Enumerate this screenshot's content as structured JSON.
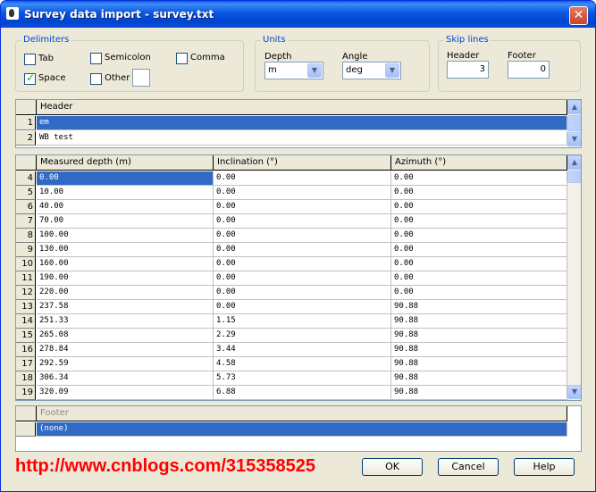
{
  "window": {
    "title": "Survey data import - survey.txt",
    "close": "✕"
  },
  "delimiters": {
    "title": "Delimiters",
    "tab": "Tab",
    "semicolon": "Semicolon",
    "comma": "Comma",
    "space": "Space",
    "other": "Other"
  },
  "units": {
    "title": "Units",
    "depth_label": "Depth",
    "depth_value": "m",
    "angle_label": "Angle",
    "angle_value": "deg"
  },
  "skip": {
    "title": "Skip lines",
    "header_label": "Header",
    "header_value": "3",
    "footer_label": "Footer",
    "footer_value": "0"
  },
  "header_grid": {
    "column": "Header",
    "rows": [
      {
        "n": "1",
        "text": "em"
      },
      {
        "n": "2",
        "text": "WB test"
      }
    ]
  },
  "data_grid": {
    "columns": [
      "Measured depth (m)",
      "Inclination (°)",
      "Azimuth (°)"
    ],
    "rows": [
      [
        "4",
        "0.00",
        "0.00",
        "0.00"
      ],
      [
        "5",
        "10.00",
        "0.00",
        "0.00"
      ],
      [
        "6",
        "40.00",
        "0.00",
        "0.00"
      ],
      [
        "7",
        "70.00",
        "0.00",
        "0.00"
      ],
      [
        "8",
        "100.00",
        "0.00",
        "0.00"
      ],
      [
        "9",
        "130.00",
        "0.00",
        "0.00"
      ],
      [
        "10",
        "160.00",
        "0.00",
        "0.00"
      ],
      [
        "11",
        "190.00",
        "0.00",
        "0.00"
      ],
      [
        "12",
        "220.00",
        "0.00",
        "0.00"
      ],
      [
        "13",
        "237.58",
        "0.00",
        "90.88"
      ],
      [
        "14",
        "251.33",
        "1.15",
        "90.88"
      ],
      [
        "15",
        "265.08",
        "2.29",
        "90.88"
      ],
      [
        "16",
        "278.84",
        "3.44",
        "90.88"
      ],
      [
        "17",
        "292.59",
        "4.58",
        "90.88"
      ],
      [
        "18",
        "306.34",
        "5.73",
        "90.88"
      ],
      [
        "19",
        "320.09",
        "6.88",
        "90.88"
      ]
    ]
  },
  "footer_grid": {
    "column": "Footer",
    "row": "(none)"
  },
  "buttons": {
    "ok": "OK",
    "cancel": "Cancel",
    "help": "Help"
  },
  "watermark": "http://www.cnblogs.com/315358525"
}
